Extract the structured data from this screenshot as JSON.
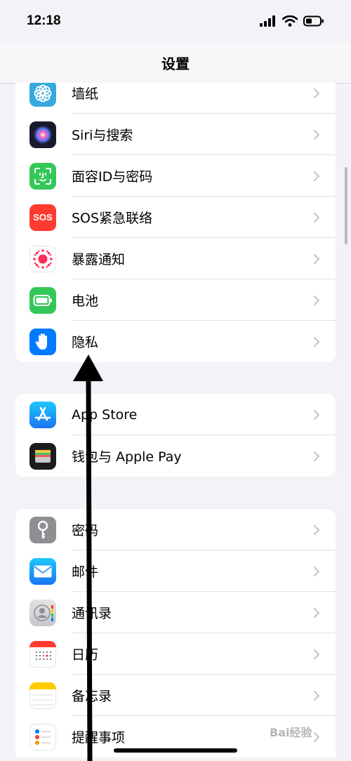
{
  "status_bar": {
    "time": "12:18"
  },
  "nav": {
    "title": "设置"
  },
  "groups": [
    {
      "rows": [
        {
          "label": "墙纸",
          "icon": "wallpaper-icon"
        },
        {
          "label": "Siri与搜索",
          "icon": "siri-icon"
        },
        {
          "label": "面容ID与密码",
          "icon": "faceid-icon"
        },
        {
          "label": "SOS紧急联络",
          "icon": "sos-icon",
          "icon_text": "SOS"
        },
        {
          "label": "暴露通知",
          "icon": "exposure-icon"
        },
        {
          "label": "电池",
          "icon": "battery-icon"
        },
        {
          "label": "隐私",
          "icon": "hand-icon"
        }
      ]
    },
    {
      "rows": [
        {
          "label": "App Store",
          "icon": "app-store-icon"
        },
        {
          "label": "钱包与 Apple Pay",
          "icon": "wallet-icon"
        }
      ]
    },
    {
      "rows": [
        {
          "label": "密码",
          "icon": "key-icon"
        },
        {
          "label": "邮件",
          "icon": "mail-icon"
        },
        {
          "label": "通讯录",
          "icon": "contacts-icon"
        },
        {
          "label": "日历",
          "icon": "calendar-icon"
        },
        {
          "label": "备忘录",
          "icon": "notes-icon"
        },
        {
          "label": "提醒事项",
          "icon": "reminders-icon"
        }
      ]
    }
  ],
  "watermark": "Bai经验"
}
